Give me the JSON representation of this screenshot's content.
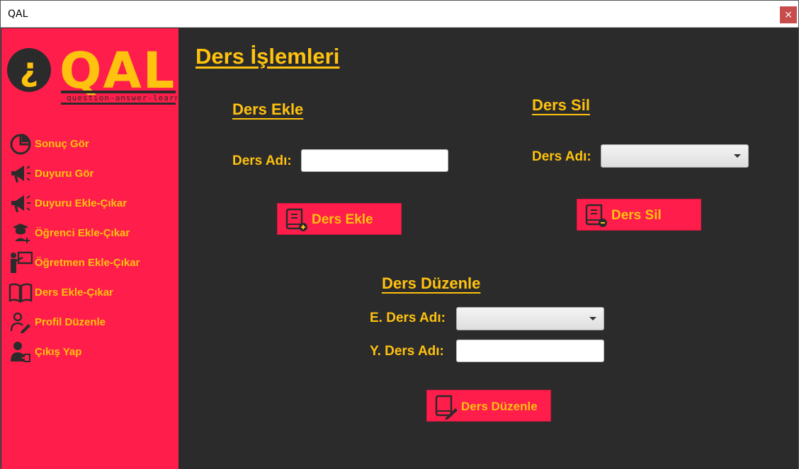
{
  "window": {
    "title": "QAL",
    "close_label": "×"
  },
  "logo": {
    "mark": "¿",
    "text": "QAL",
    "tagline": "question-answer-learn"
  },
  "sidebar": {
    "items": [
      {
        "label": "Sonuç Gör",
        "icon": "pie-chart-icon"
      },
      {
        "label": "Duyuru Gör",
        "icon": "megaphone-icon"
      },
      {
        "label": "Duyuru Ekle-Çıkar",
        "icon": "megaphone-icon"
      },
      {
        "label": "Öğrenci Ekle-Çıkar",
        "icon": "student-icon"
      },
      {
        "label": "Öğretmen Ekle-Çıkar",
        "icon": "teacher-icon"
      },
      {
        "label": "Ders Ekle-Çıkar",
        "icon": "book-icon"
      },
      {
        "label": "Profil Düzenle",
        "icon": "user-edit-icon"
      },
      {
        "label": "Çıkış Yap",
        "icon": "logout-icon"
      }
    ]
  },
  "main": {
    "title": "Ders İşlemleri",
    "add": {
      "heading": "Ders Ekle",
      "name_label": "Ders Adı:",
      "name_value": "",
      "button_label": "Ders Ekle"
    },
    "delete": {
      "heading": "Ders Sil",
      "name_label": "Ders Adı:",
      "selected": "",
      "button_label": "Ders Sil"
    },
    "edit": {
      "heading": "Ders Düzenle",
      "old_label": "E. Ders Adı:",
      "old_selected": "",
      "new_label": "Y. Ders Adı:",
      "new_value": "",
      "button_label": "Ders Düzenle"
    }
  },
  "colors": {
    "accent": "#ffc20e",
    "brand": "#ff1e4b",
    "background": "#2b2b2b",
    "icon_dark": "#2b2b2b"
  }
}
